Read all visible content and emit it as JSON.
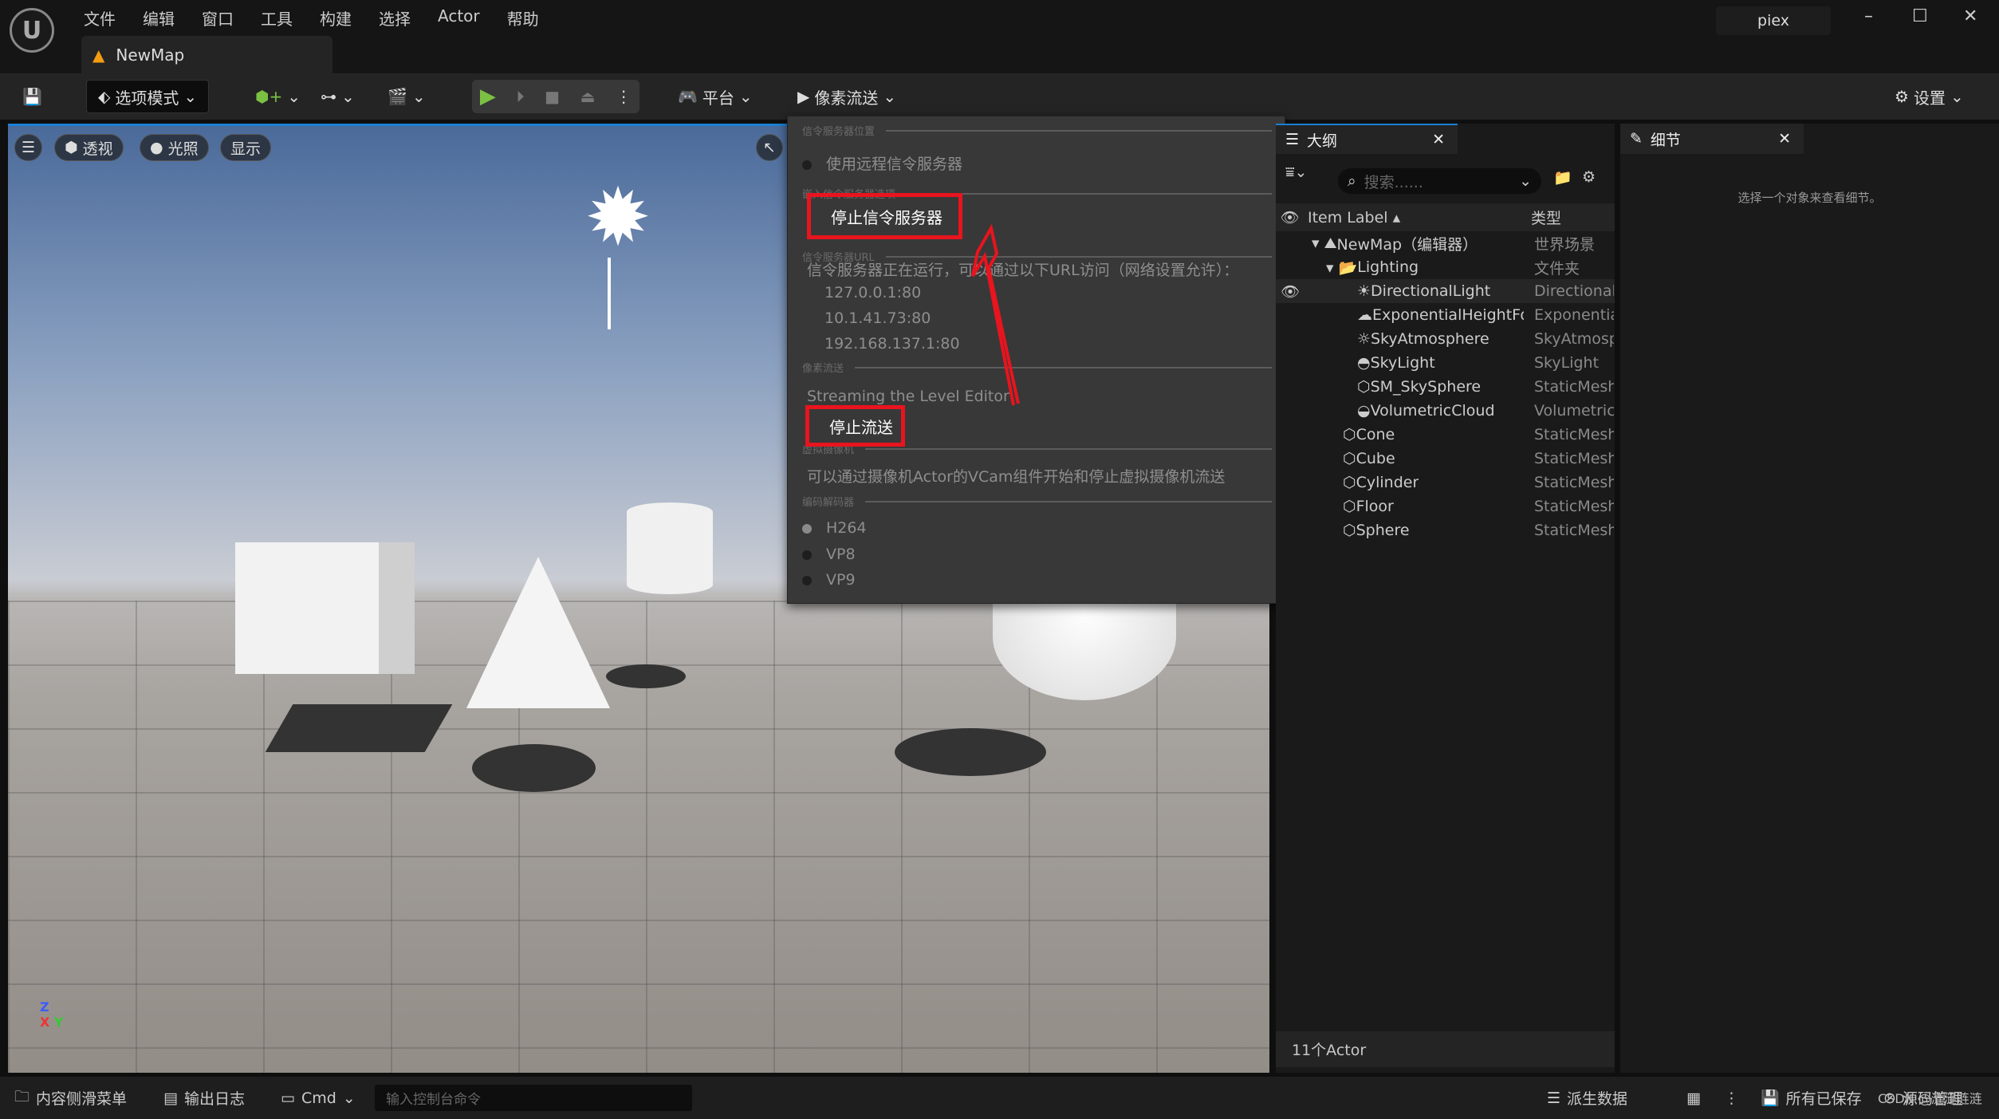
{
  "menubar": {
    "items": [
      "文件",
      "编辑",
      "窗口",
      "工具",
      "构建",
      "选择",
      "Actor",
      "帮助"
    ],
    "user": "piex",
    "doc_tab": "NewMap"
  },
  "toolbar": {
    "mode": "选项模式",
    "platform": "平台",
    "pixel_streaming": "像素流送",
    "settings": "设置"
  },
  "viewport": {
    "menu": "☰",
    "perspective": "透视",
    "lighting": "光照",
    "show": "显示"
  },
  "dropdown": {
    "sec_location": "信令服务器位置",
    "use_remote": "使用远程信令服务器",
    "sec_embedded": "嵌入信令服务器选项",
    "stop_server": "停止信令服务器",
    "sec_url": "信令服务器URL",
    "running_msg": "信令服务器正在运行，可以通过以下URL访问（网络设置允许）：",
    "urls": [
      "127.0.0.1:80",
      "10.1.41.73:80",
      "192.168.137.1:80"
    ],
    "sec_stream": "像素流送",
    "streaming_label": "Streaming the Level Editor",
    "stop_stream": "停止流送",
    "sec_vcam": "虚拟摄像机",
    "vcam_msg": "可以通过摄像机Actor的VCam组件开始和停止虚拟摄像机流送",
    "sec_codec": "编码解码器",
    "codecs": [
      "H264",
      "VP8",
      "VP9"
    ],
    "selected_codec": "H264",
    "annotation_color": "#e8141e"
  },
  "outliner": {
    "tab": "大纲",
    "search_placeholder": "搜索......",
    "col_label": "Item Label",
    "col_type": "类型",
    "rows": [
      {
        "label": "NewMap（编辑器）",
        "type": "世界场景"
      },
      {
        "label": "Lighting",
        "type": "文件夹"
      },
      {
        "label": "DirectionalLight",
        "type": "DirectionalLight"
      },
      {
        "label": "ExponentialHeightFog",
        "type": "ExponentialHeightFog"
      },
      {
        "label": "SkyAtmosphere",
        "type": "SkyAtmosphere"
      },
      {
        "label": "SkyLight",
        "type": "SkyLight"
      },
      {
        "label": "SM_SkySphere",
        "type": "StaticMesh"
      },
      {
        "label": "VolumetricCloud",
        "type": "VolumetricCloud"
      },
      {
        "label": "Cone",
        "type": "StaticMesh"
      },
      {
        "label": "Cube",
        "type": "StaticMesh"
      },
      {
        "label": "Cylinder",
        "type": "StaticMesh"
      },
      {
        "label": "Floor",
        "type": "StaticMesh"
      },
      {
        "label": "Sphere",
        "type": "StaticMesh"
      }
    ],
    "count": "11个Actor"
  },
  "details": {
    "tab": "细节",
    "empty_msg": "选择一个对象来查看细节。"
  },
  "statusbar": {
    "content_drawer": "内容侧滑菜单",
    "output_log": "输出日志",
    "cmd": "Cmd",
    "cmd_placeholder": "输入控制台命令",
    "derived_data": "派生数据",
    "saved": "所有已保存",
    "source_control": "源码管理",
    "watermark": "CSDN @涟涟涟涟"
  }
}
